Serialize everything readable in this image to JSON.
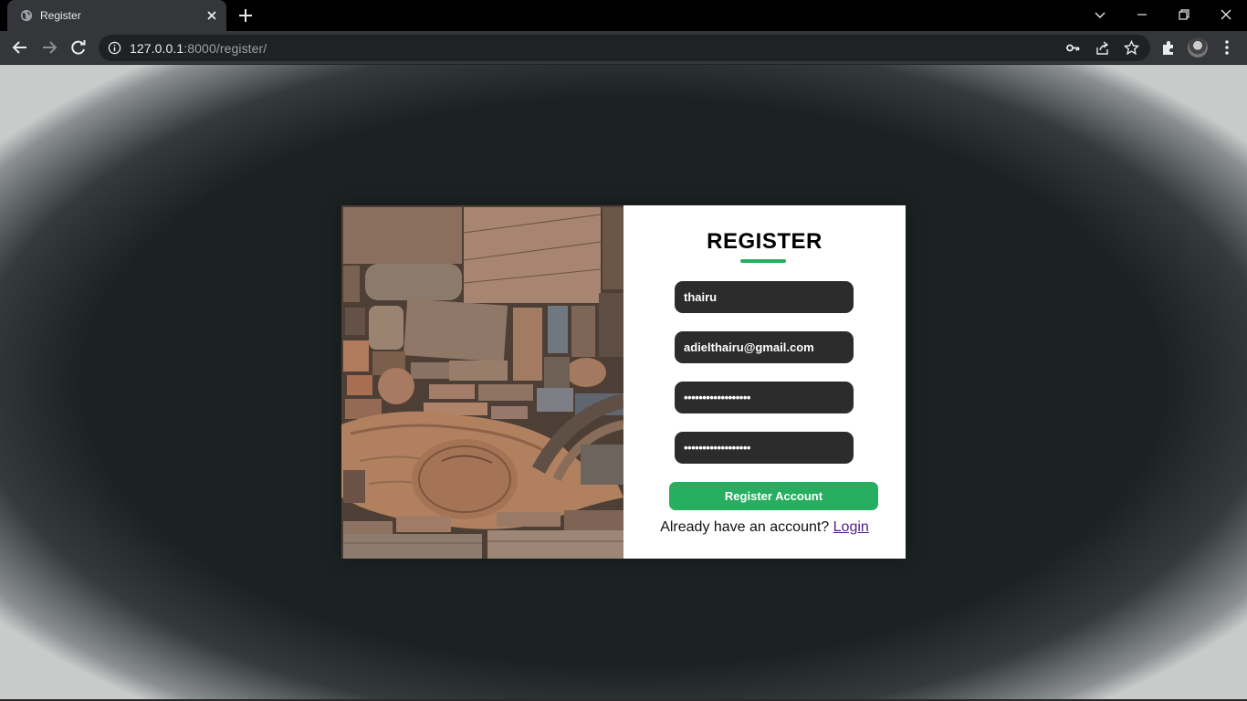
{
  "browser": {
    "tab_title": "Register",
    "url_host": "127.0.0.1",
    "url_rest": ":8000/register/"
  },
  "form": {
    "title": "REGISTER",
    "username_value": "thairu",
    "email_value": "adielthairu@gmail.com",
    "password_value": "••••••••••••••••••",
    "confirm_password_value": "••••••••••••••••••",
    "submit_label": "Register Account",
    "login_prompt": "Already have an account?",
    "login_link": "Login"
  },
  "colors": {
    "accent": "#27ae60",
    "field_bg": "#2c2c2c",
    "chrome_bg": "#35363a",
    "link": "#551a8b"
  }
}
